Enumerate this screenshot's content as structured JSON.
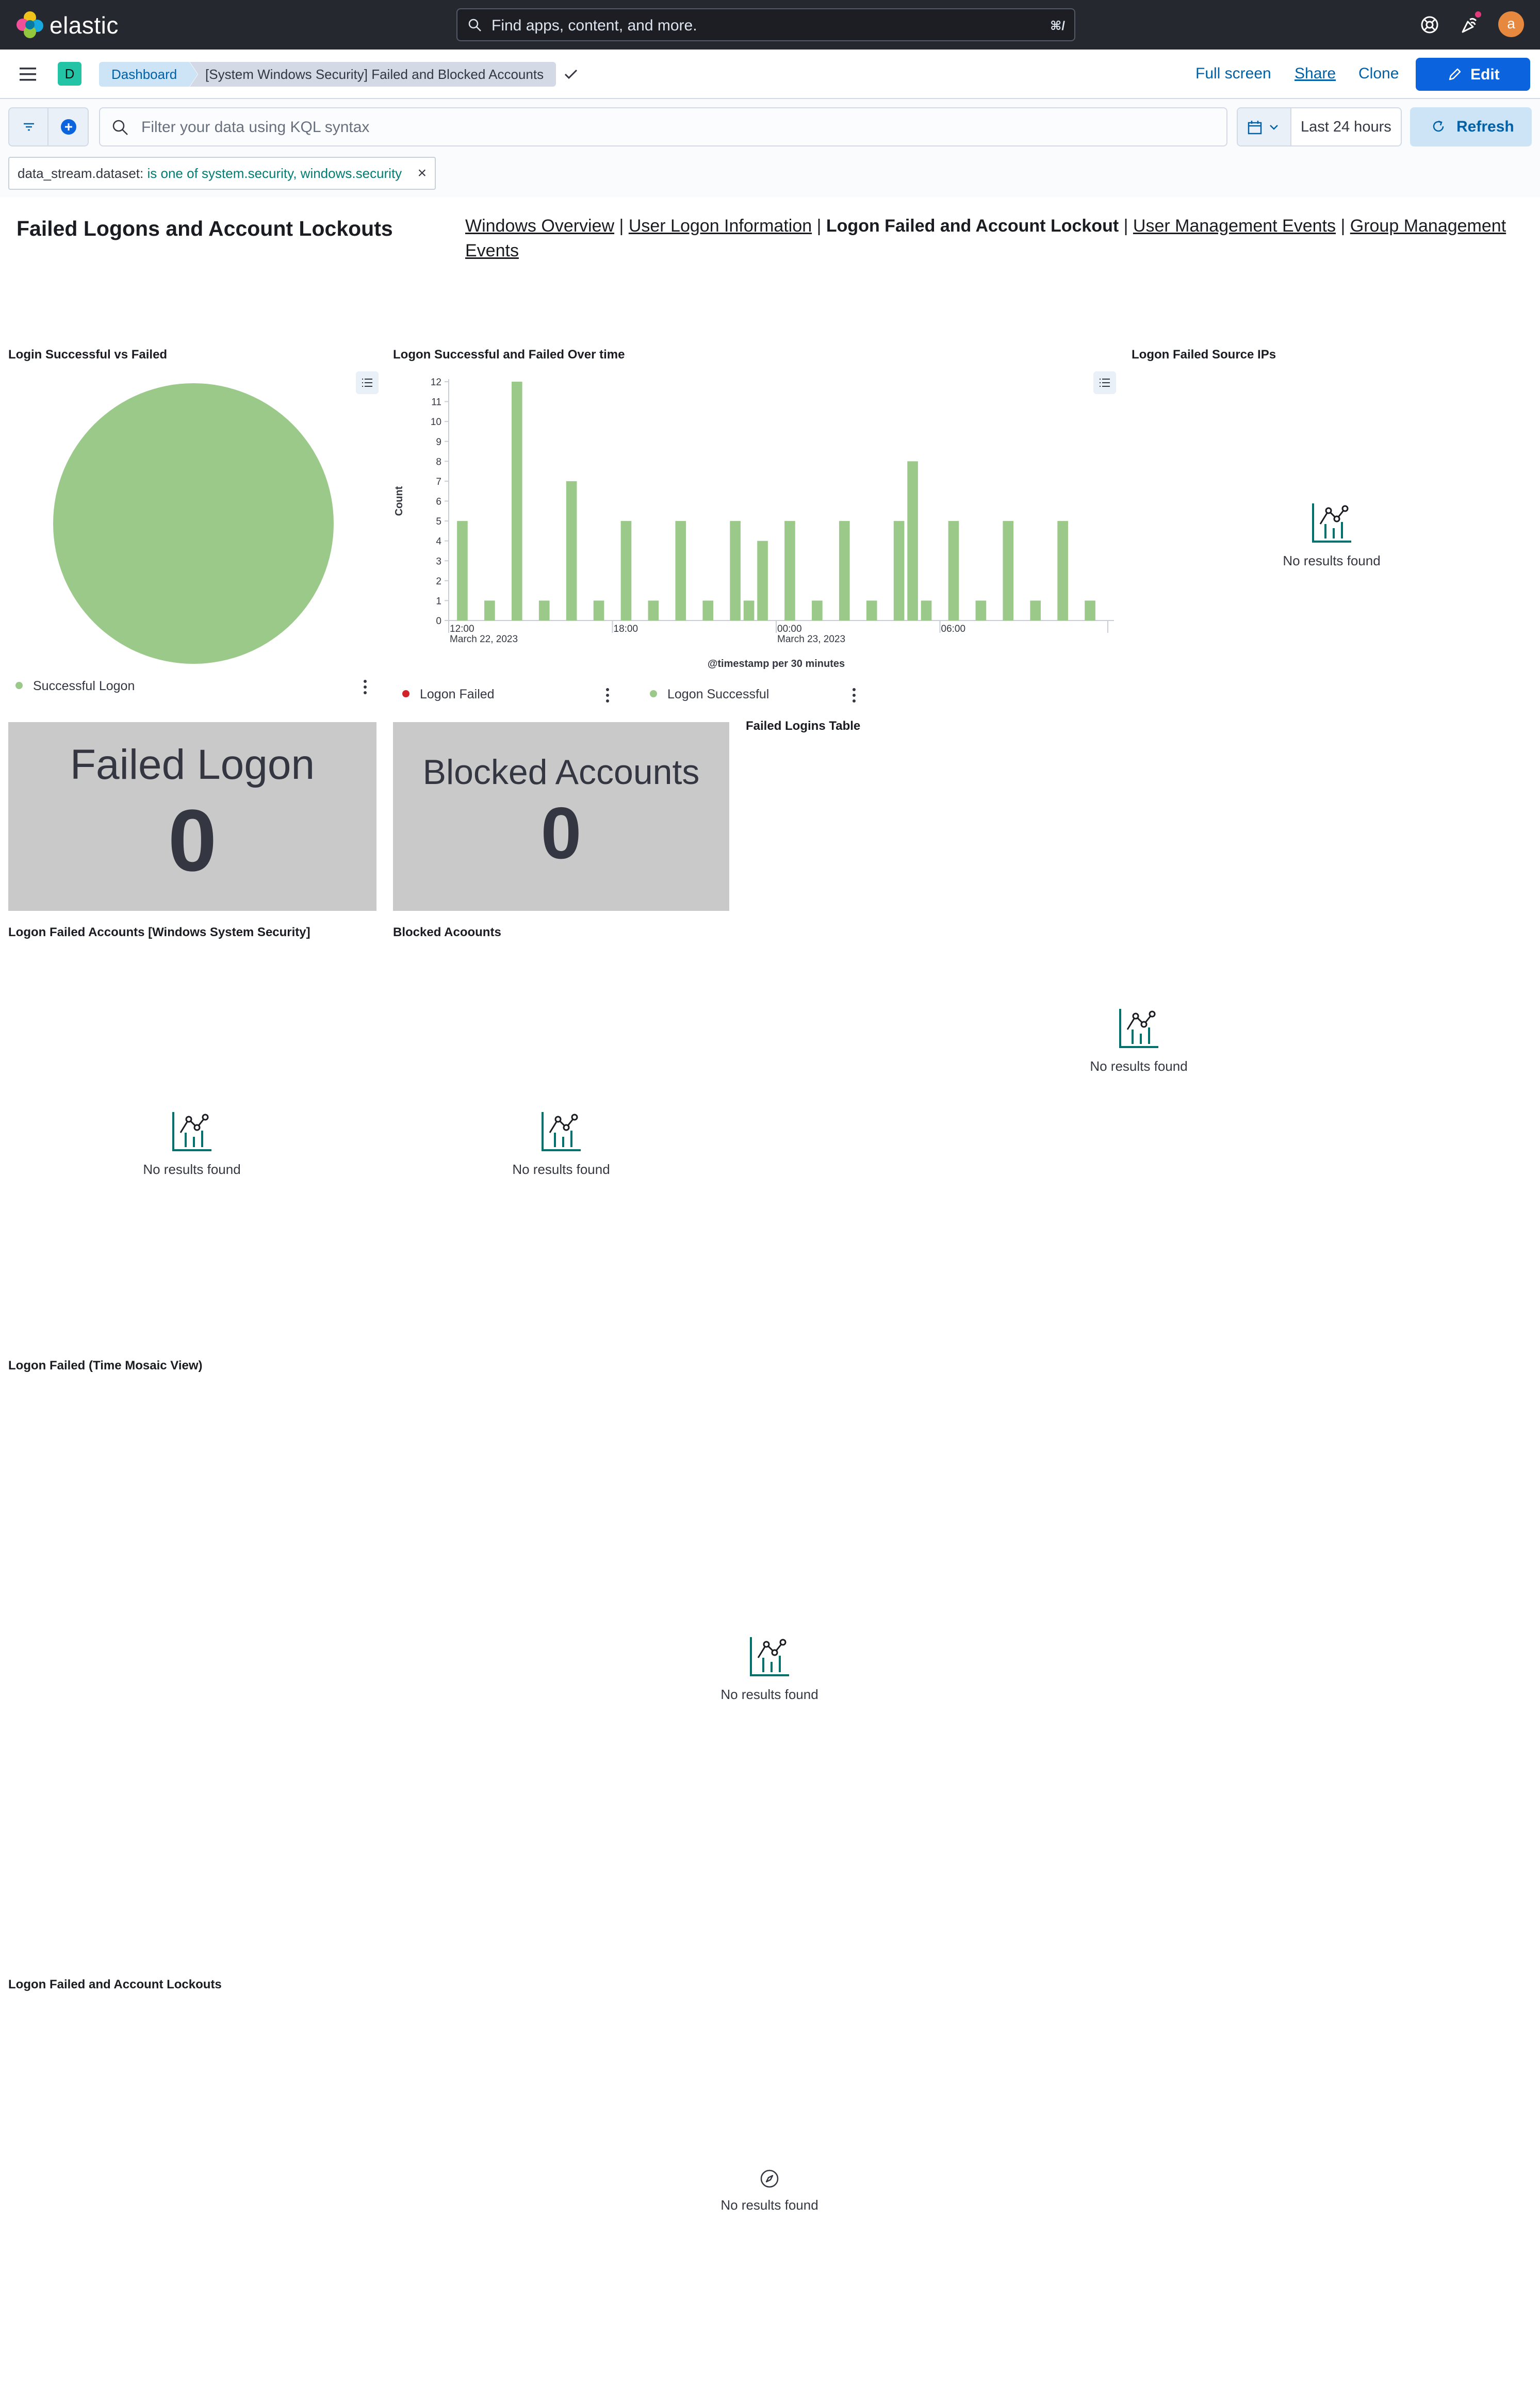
{
  "header": {
    "brand": "elastic",
    "search_placeholder": "Find apps, content, and more.",
    "search_shortcut": "⌘/",
    "avatar_initial": "a"
  },
  "nav": {
    "app_badge": "D",
    "breadcrumb_app": "Dashboard",
    "breadcrumb_page": "[System Windows Security] Failed and Blocked Accounts",
    "full_screen": "Full screen",
    "share": "Share",
    "clone": "Clone",
    "edit": "Edit"
  },
  "query": {
    "placeholder": "Filter your data using KQL syntax",
    "time_range": "Last 24 hours",
    "refresh": "Refresh",
    "filter_pill": {
      "field": "data_stream.dataset:",
      "value": "is one of system.security, windows.security"
    }
  },
  "markdown": {
    "title": "Failed Logons and Account Lockouts",
    "links": [
      {
        "label": "Windows Overview",
        "active": false
      },
      {
        "label": "User Logon Information",
        "active": false
      },
      {
        "label": "Logon Failed and Account Lockout",
        "active": true
      },
      {
        "label": "User Management Events",
        "active": false
      },
      {
        "label": "Group Management Events",
        "active": false
      }
    ],
    "separator": "|"
  },
  "panels": {
    "pie": {
      "title": "Login Successful vs Failed",
      "legend": "Successful Logon"
    },
    "over_time": {
      "title": "Logon Successful and Failed Over time",
      "legend_failed": "Logon Failed",
      "legend_success": "Logon Successful"
    },
    "source_ips": {
      "title": "Logon Failed Source IPs",
      "empty": "No results found"
    },
    "failed_metric": {
      "label": "Failed Logon",
      "value": "0",
      "title": "Logon Failed Accounts [Windows System Security]",
      "empty": "No results found"
    },
    "blocked_metric": {
      "label": "Blocked Accounts",
      "value": "0",
      "title": "Blocked Acoounts",
      "empty": "No results found"
    },
    "failed_table": {
      "title": "Failed Logins Table",
      "empty": "No results found"
    },
    "mosaic": {
      "title": "Logon Failed (Time Mosaic View)",
      "empty": "No results found"
    },
    "lockouts": {
      "title": "Logon Failed and Account Lockouts",
      "empty": "No results found"
    }
  },
  "colors": {
    "success": "#9bc989",
    "failed": "#d1232a",
    "accent": "#0b64dd",
    "header_bg": "#25282f",
    "metric_bg": "#c9c9c9",
    "empty_icon": "#00706d"
  },
  "chart_data": [
    {
      "type": "pie",
      "title": "Login Successful vs Failed",
      "slices": [
        {
          "label": "Successful Logon",
          "value": 100,
          "color": "#9bc989"
        }
      ],
      "legend": "bottom"
    },
    {
      "type": "bar",
      "title": "Logon Successful and Failed Over time",
      "xlabel": "@timestamp per 30 minutes",
      "ylabel": "Count",
      "ylim": [
        0,
        12
      ],
      "yticks": [
        0,
        1,
        2,
        3,
        4,
        5,
        6,
        7,
        8,
        9,
        10,
        11,
        12
      ],
      "x_start": "2023-03-22 12:00",
      "x_end": "2023-03-23 12:00",
      "x_ticks": [
        {
          "label": "12:00",
          "sub": "March 22, 2023",
          "time": "2023-03-22 12:00"
        },
        {
          "label": "18:00",
          "sub": "",
          "time": "2023-03-22 18:00"
        },
        {
          "label": "00:00",
          "sub": "March 23, 2023",
          "time": "2023-03-23 00:00"
        },
        {
          "label": "06:00",
          "sub": "",
          "time": "2023-03-23 06:00"
        }
      ],
      "series": [
        {
          "name": "Logon Successful",
          "color": "#9bc989",
          "points": [
            {
              "t": "2023-03-22 12:30",
              "v": 5
            },
            {
              "t": "2023-03-22 13:30",
              "v": 1
            },
            {
              "t": "2023-03-22 14:30",
              "v": 12
            },
            {
              "t": "2023-03-22 15:30",
              "v": 1
            },
            {
              "t": "2023-03-22 16:30",
              "v": 7
            },
            {
              "t": "2023-03-22 17:30",
              "v": 1
            },
            {
              "t": "2023-03-22 18:30",
              "v": 5
            },
            {
              "t": "2023-03-22 19:30",
              "v": 1
            },
            {
              "t": "2023-03-22 20:30",
              "v": 5
            },
            {
              "t": "2023-03-22 21:30",
              "v": 1
            },
            {
              "t": "2023-03-22 22:30",
              "v": 5
            },
            {
              "t": "2023-03-22 23:00",
              "v": 1
            },
            {
              "t": "2023-03-22 23:30",
              "v": 4
            },
            {
              "t": "2023-03-23 00:30",
              "v": 5
            },
            {
              "t": "2023-03-23 01:30",
              "v": 1
            },
            {
              "t": "2023-03-23 02:30",
              "v": 5
            },
            {
              "t": "2023-03-23 03:30",
              "v": 1
            },
            {
              "t": "2023-03-23 04:30",
              "v": 5
            },
            {
              "t": "2023-03-23 05:00",
              "v": 8
            },
            {
              "t": "2023-03-23 05:30",
              "v": 1
            },
            {
              "t": "2023-03-23 06:30",
              "v": 5
            },
            {
              "t": "2023-03-23 07:30",
              "v": 1
            },
            {
              "t": "2023-03-23 08:30",
              "v": 5
            },
            {
              "t": "2023-03-23 09:30",
              "v": 1
            },
            {
              "t": "2023-03-23 10:30",
              "v": 5
            },
            {
              "t": "2023-03-23 11:30",
              "v": 1
            }
          ]
        },
        {
          "name": "Logon Failed",
          "color": "#d1232a",
          "points": []
        }
      ],
      "grid": false,
      "legend": "bottom"
    }
  ]
}
